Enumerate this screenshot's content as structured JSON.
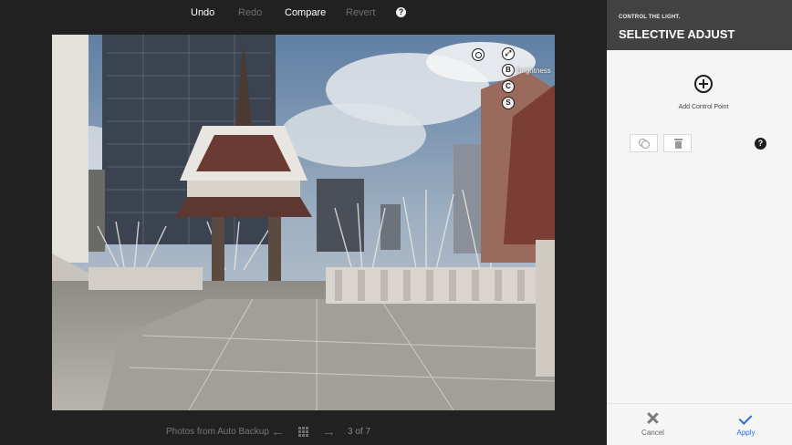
{
  "toolbar": {
    "undo_label": "Undo",
    "redo_label": "Redo",
    "compare_label": "Compare",
    "revert_label": "Revert",
    "help_glyph": "?"
  },
  "control_point": {
    "buttons": [
      "B",
      "C",
      "S"
    ],
    "label": "Brightness"
  },
  "bottom_bar": {
    "album_label": "Photos from Auto Backup",
    "counter": "3 of 7",
    "prev_glyph": "←",
    "next_glyph": "→"
  },
  "panel": {
    "subtitle": "CONTROL THE LIGHT.",
    "title": "SELECTIVE ADJUST",
    "add_control_point_label": "Add Control Point",
    "help_glyph": "?",
    "cancel_label": "Cancel",
    "apply_label": "Apply"
  },
  "colors": {
    "apply_accent": "#2a6fd6",
    "panel_header": "#424242",
    "editor_background": "#222122"
  },
  "icons": [
    "help-icon",
    "expand-icon",
    "add-circle-icon",
    "duplicate-icon",
    "trash-icon",
    "close-icon",
    "check-icon",
    "arrow-left-icon",
    "grid-icon",
    "arrow-right-icon"
  ]
}
